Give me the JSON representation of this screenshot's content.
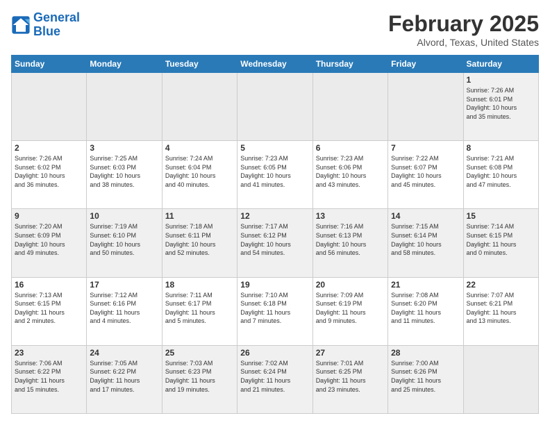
{
  "header": {
    "logo_line1": "General",
    "logo_line2": "Blue",
    "month_title": "February 2025",
    "location": "Alvord, Texas, United States"
  },
  "weekdays": [
    "Sunday",
    "Monday",
    "Tuesday",
    "Wednesday",
    "Thursday",
    "Friday",
    "Saturday"
  ],
  "weeks": [
    [
      {
        "day": "",
        "info": ""
      },
      {
        "day": "",
        "info": ""
      },
      {
        "day": "",
        "info": ""
      },
      {
        "day": "",
        "info": ""
      },
      {
        "day": "",
        "info": ""
      },
      {
        "day": "",
        "info": ""
      },
      {
        "day": "1",
        "info": "Sunrise: 7:26 AM\nSunset: 6:01 PM\nDaylight: 10 hours\nand 35 minutes."
      }
    ],
    [
      {
        "day": "2",
        "info": "Sunrise: 7:26 AM\nSunset: 6:02 PM\nDaylight: 10 hours\nand 36 minutes."
      },
      {
        "day": "3",
        "info": "Sunrise: 7:25 AM\nSunset: 6:03 PM\nDaylight: 10 hours\nand 38 minutes."
      },
      {
        "day": "4",
        "info": "Sunrise: 7:24 AM\nSunset: 6:04 PM\nDaylight: 10 hours\nand 40 minutes."
      },
      {
        "day": "5",
        "info": "Sunrise: 7:23 AM\nSunset: 6:05 PM\nDaylight: 10 hours\nand 41 minutes."
      },
      {
        "day": "6",
        "info": "Sunrise: 7:23 AM\nSunset: 6:06 PM\nDaylight: 10 hours\nand 43 minutes."
      },
      {
        "day": "7",
        "info": "Sunrise: 7:22 AM\nSunset: 6:07 PM\nDaylight: 10 hours\nand 45 minutes."
      },
      {
        "day": "8",
        "info": "Sunrise: 7:21 AM\nSunset: 6:08 PM\nDaylight: 10 hours\nand 47 minutes."
      }
    ],
    [
      {
        "day": "9",
        "info": "Sunrise: 7:20 AM\nSunset: 6:09 PM\nDaylight: 10 hours\nand 49 minutes."
      },
      {
        "day": "10",
        "info": "Sunrise: 7:19 AM\nSunset: 6:10 PM\nDaylight: 10 hours\nand 50 minutes."
      },
      {
        "day": "11",
        "info": "Sunrise: 7:18 AM\nSunset: 6:11 PM\nDaylight: 10 hours\nand 52 minutes."
      },
      {
        "day": "12",
        "info": "Sunrise: 7:17 AM\nSunset: 6:12 PM\nDaylight: 10 hours\nand 54 minutes."
      },
      {
        "day": "13",
        "info": "Sunrise: 7:16 AM\nSunset: 6:13 PM\nDaylight: 10 hours\nand 56 minutes."
      },
      {
        "day": "14",
        "info": "Sunrise: 7:15 AM\nSunset: 6:14 PM\nDaylight: 10 hours\nand 58 minutes."
      },
      {
        "day": "15",
        "info": "Sunrise: 7:14 AM\nSunset: 6:15 PM\nDaylight: 11 hours\nand 0 minutes."
      }
    ],
    [
      {
        "day": "16",
        "info": "Sunrise: 7:13 AM\nSunset: 6:15 PM\nDaylight: 11 hours\nand 2 minutes."
      },
      {
        "day": "17",
        "info": "Sunrise: 7:12 AM\nSunset: 6:16 PM\nDaylight: 11 hours\nand 4 minutes."
      },
      {
        "day": "18",
        "info": "Sunrise: 7:11 AM\nSunset: 6:17 PM\nDaylight: 11 hours\nand 5 minutes."
      },
      {
        "day": "19",
        "info": "Sunrise: 7:10 AM\nSunset: 6:18 PM\nDaylight: 11 hours\nand 7 minutes."
      },
      {
        "day": "20",
        "info": "Sunrise: 7:09 AM\nSunset: 6:19 PM\nDaylight: 11 hours\nand 9 minutes."
      },
      {
        "day": "21",
        "info": "Sunrise: 7:08 AM\nSunset: 6:20 PM\nDaylight: 11 hours\nand 11 minutes."
      },
      {
        "day": "22",
        "info": "Sunrise: 7:07 AM\nSunset: 6:21 PM\nDaylight: 11 hours\nand 13 minutes."
      }
    ],
    [
      {
        "day": "23",
        "info": "Sunrise: 7:06 AM\nSunset: 6:22 PM\nDaylight: 11 hours\nand 15 minutes."
      },
      {
        "day": "24",
        "info": "Sunrise: 7:05 AM\nSunset: 6:22 PM\nDaylight: 11 hours\nand 17 minutes."
      },
      {
        "day": "25",
        "info": "Sunrise: 7:03 AM\nSunset: 6:23 PM\nDaylight: 11 hours\nand 19 minutes."
      },
      {
        "day": "26",
        "info": "Sunrise: 7:02 AM\nSunset: 6:24 PM\nDaylight: 11 hours\nand 21 minutes."
      },
      {
        "day": "27",
        "info": "Sunrise: 7:01 AM\nSunset: 6:25 PM\nDaylight: 11 hours\nand 23 minutes."
      },
      {
        "day": "28",
        "info": "Sunrise: 7:00 AM\nSunset: 6:26 PM\nDaylight: 11 hours\nand 25 minutes."
      },
      {
        "day": "",
        "info": ""
      }
    ]
  ]
}
